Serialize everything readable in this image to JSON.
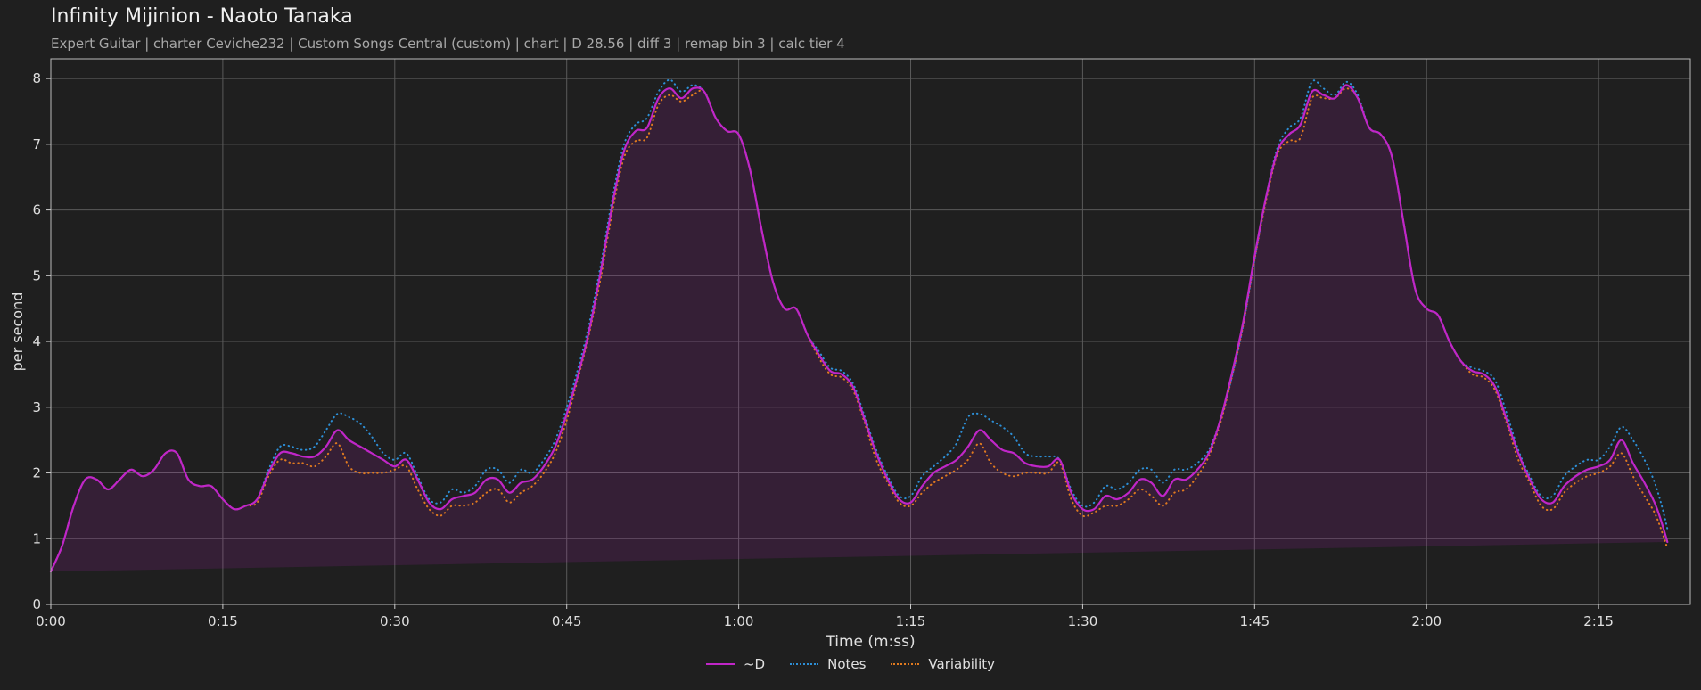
{
  "header": {
    "title": "Infinity Mijinion - Naoto Tanaka",
    "subtitle": "Expert Guitar  |  charter Ceviche232  |  Custom Songs Central (custom)  |  chart  |  D 28.56  |  diff 3  |  remap bin 3  |  calc tier 4"
  },
  "chart_data": {
    "type": "line",
    "xlabel": "Time (m:ss)",
    "ylabel": "per second",
    "xlim": [
      0,
      143
    ],
    "ylim": [
      0,
      8.3
    ],
    "x_ticks": [
      {
        "v": 0,
        "label": "0:00"
      },
      {
        "v": 15,
        "label": "0:15"
      },
      {
        "v": 30,
        "label": "0:30"
      },
      {
        "v": 45,
        "label": "0:45"
      },
      {
        "v": 60,
        "label": "1:00"
      },
      {
        "v": 75,
        "label": "1:15"
      },
      {
        "v": 90,
        "label": "1:30"
      },
      {
        "v": 105,
        "label": "1:45"
      },
      {
        "v": 120,
        "label": "2:00"
      },
      {
        "v": 135,
        "label": "2:15"
      }
    ],
    "y_ticks": [
      0,
      1,
      2,
      3,
      4,
      5,
      6,
      7,
      8
    ],
    "grid": true,
    "legend_position": "bottom-center",
    "x": [
      0,
      1,
      2,
      3,
      4,
      5,
      6,
      7,
      8,
      9,
      10,
      11,
      12,
      13,
      14,
      15,
      16,
      17,
      18,
      19,
      20,
      21,
      22,
      23,
      24,
      25,
      26,
      27,
      28,
      29,
      30,
      31,
      32,
      33,
      34,
      35,
      36,
      37,
      38,
      39,
      40,
      41,
      42,
      43,
      44,
      45,
      46,
      47,
      48,
      49,
      50,
      51,
      52,
      53,
      54,
      55,
      56,
      57,
      58,
      59,
      60,
      61,
      62,
      63,
      64,
      65,
      66,
      67,
      68,
      69,
      70,
      71,
      72,
      73,
      74,
      75,
      76,
      77,
      78,
      79,
      80,
      81,
      82,
      83,
      84,
      85,
      86,
      87,
      88,
      89,
      90,
      91,
      92,
      93,
      94,
      95,
      96,
      97,
      98,
      99,
      100,
      101,
      102,
      103,
      104,
      105,
      106,
      107,
      108,
      109,
      110,
      111,
      112,
      113,
      114,
      115,
      116,
      117,
      118,
      119,
      120,
      121,
      122,
      123,
      124,
      125,
      126,
      127,
      128,
      129,
      130,
      131,
      132,
      133,
      134,
      135,
      136,
      137,
      138,
      139,
      140,
      141,
      142,
      143
    ],
    "series": [
      {
        "name": "~D",
        "color": "#c026c8",
        "style": "solid",
        "values": [
          0.5,
          0.9,
          1.5,
          1.9,
          1.9,
          1.75,
          1.9,
          2.05,
          1.95,
          2.05,
          2.3,
          2.3,
          1.9,
          1.8,
          1.8,
          1.6,
          1.45,
          1.5,
          1.6,
          2.0,
          2.3,
          2.3,
          2.25,
          2.25,
          2.4,
          2.65,
          2.5,
          2.4,
          2.3,
          2.2,
          2.1,
          2.2,
          1.9,
          1.55,
          1.45,
          1.6,
          1.65,
          1.7,
          1.9,
          1.9,
          1.7,
          1.85,
          1.9,
          2.1,
          2.4,
          2.9,
          3.5,
          4.2,
          5.1,
          6.1,
          6.9,
          7.2,
          7.25,
          7.7,
          7.85,
          7.7,
          7.85,
          7.8,
          7.4,
          7.2,
          7.15,
          6.6,
          5.7,
          4.9,
          4.5,
          4.5,
          4.1,
          3.8,
          3.55,
          3.5,
          3.3,
          2.8,
          2.3,
          1.9,
          1.6,
          1.55,
          1.8,
          2.0,
          2.1,
          2.2,
          2.4,
          2.65,
          2.5,
          2.35,
          2.3,
          2.15,
          2.1,
          2.1,
          2.2,
          1.7,
          1.45,
          1.45,
          1.65,
          1.6,
          1.7,
          1.9,
          1.85,
          1.65,
          1.9,
          1.9,
          2.05,
          2.3,
          2.8,
          3.5,
          4.3,
          5.3,
          6.2,
          6.9,
          7.15,
          7.3,
          7.8,
          7.75,
          7.7,
          7.9,
          7.7,
          7.25,
          7.15,
          6.8,
          5.8,
          4.8,
          4.5,
          4.4,
          4.0,
          3.7,
          3.55,
          3.5,
          3.3,
          2.8,
          2.3,
          1.9,
          1.6,
          1.55,
          1.8,
          1.95,
          2.05,
          2.1,
          2.2,
          2.5,
          2.15,
          1.85,
          1.5,
          0.95,
          0.25
        ]
      },
      {
        "name": "Notes",
        "color": "#2d8fd6",
        "style": "dotted",
        "values": [
          0.5,
          0.9,
          1.5,
          1.9,
          1.9,
          1.75,
          1.9,
          2.05,
          1.95,
          2.05,
          2.3,
          2.3,
          1.9,
          1.8,
          1.8,
          1.6,
          1.45,
          1.5,
          1.6,
          2.05,
          2.4,
          2.4,
          2.35,
          2.4,
          2.65,
          2.9,
          2.85,
          2.75,
          2.55,
          2.3,
          2.2,
          2.3,
          1.95,
          1.6,
          1.55,
          1.75,
          1.7,
          1.8,
          2.05,
          2.05,
          1.85,
          2.05,
          2.0,
          2.2,
          2.5,
          3.0,
          3.6,
          4.3,
          5.2,
          6.2,
          7.0,
          7.3,
          7.4,
          7.8,
          7.98,
          7.8,
          7.9,
          7.8,
          7.4,
          7.2,
          7.15,
          6.6,
          5.7,
          4.9,
          4.5,
          4.5,
          4.1,
          3.85,
          3.6,
          3.55,
          3.35,
          2.85,
          2.35,
          1.95,
          1.65,
          1.65,
          1.95,
          2.1,
          2.25,
          2.45,
          2.85,
          2.9,
          2.8,
          2.7,
          2.55,
          2.3,
          2.25,
          2.25,
          2.2,
          1.75,
          1.5,
          1.55,
          1.8,
          1.75,
          1.85,
          2.05,
          2.05,
          1.85,
          2.05,
          2.05,
          2.15,
          2.35,
          2.8,
          3.45,
          4.25,
          5.25,
          6.2,
          6.95,
          7.25,
          7.4,
          7.95,
          7.85,
          7.75,
          7.95,
          7.75,
          7.25,
          7.15,
          6.8,
          5.8,
          4.8,
          4.5,
          4.4,
          4.0,
          3.7,
          3.6,
          3.55,
          3.4,
          2.9,
          2.35,
          1.95,
          1.65,
          1.65,
          1.95,
          2.1,
          2.2,
          2.2,
          2.4,
          2.7,
          2.5,
          2.2,
          1.8,
          1.15,
          0.25
        ]
      },
      {
        "name": "Variability",
        "color": "#e07a1f",
        "style": "dotted",
        "values": [
          0.5,
          0.9,
          1.5,
          1.9,
          1.9,
          1.75,
          1.9,
          2.05,
          1.95,
          2.05,
          2.3,
          2.3,
          1.9,
          1.8,
          1.8,
          1.6,
          1.45,
          1.5,
          1.55,
          1.95,
          2.2,
          2.15,
          2.15,
          2.1,
          2.25,
          2.45,
          2.1,
          2.0,
          2.0,
          2.0,
          2.05,
          2.1,
          1.75,
          1.45,
          1.35,
          1.5,
          1.5,
          1.55,
          1.7,
          1.75,
          1.55,
          1.7,
          1.8,
          2.0,
          2.3,
          2.8,
          3.45,
          4.15,
          5.0,
          6.0,
          6.8,
          7.05,
          7.1,
          7.6,
          7.75,
          7.65,
          7.75,
          7.8,
          7.4,
          7.2,
          7.15,
          6.6,
          5.7,
          4.9,
          4.5,
          4.5,
          4.1,
          3.75,
          3.5,
          3.45,
          3.25,
          2.75,
          2.2,
          1.85,
          1.55,
          1.5,
          1.7,
          1.85,
          1.95,
          2.05,
          2.2,
          2.45,
          2.15,
          2.0,
          1.95,
          2.0,
          2.0,
          2.0,
          2.15,
          1.6,
          1.35,
          1.4,
          1.5,
          1.5,
          1.6,
          1.75,
          1.65,
          1.5,
          1.7,
          1.75,
          1.95,
          2.25,
          2.75,
          3.45,
          4.25,
          5.25,
          6.15,
          6.85,
          7.05,
          7.1,
          7.7,
          7.7,
          7.7,
          7.85,
          7.7,
          7.25,
          7.15,
          6.8,
          5.8,
          4.8,
          4.5,
          4.4,
          4.0,
          3.7,
          3.5,
          3.45,
          3.25,
          2.75,
          2.2,
          1.85,
          1.5,
          1.45,
          1.7,
          1.85,
          1.95,
          2.0,
          2.1,
          2.3,
          1.95,
          1.65,
          1.35,
          0.85,
          0.25
        ]
      }
    ]
  }
}
